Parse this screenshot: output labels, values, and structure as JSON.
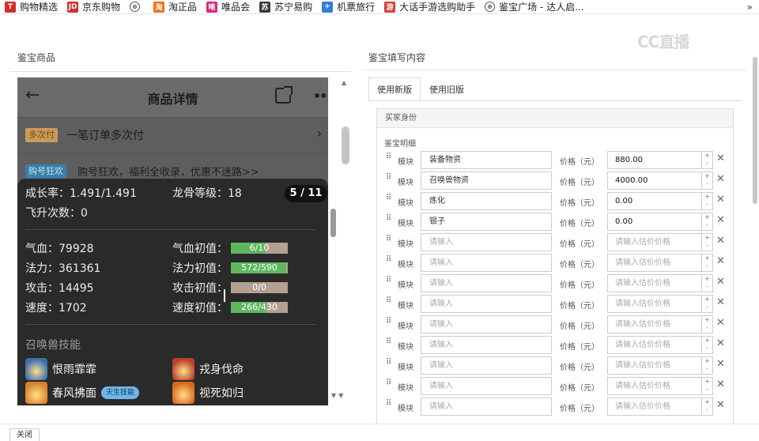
{
  "bookmarks": [
    {
      "label": "购物精选",
      "icon": "shopping-icon",
      "color": "#d62e2e",
      "glyph": "T"
    },
    {
      "label": "京东购物",
      "icon": "jd-icon",
      "color": "#d63028",
      "glyph": "JD"
    },
    {
      "label": "",
      "icon": "globe-icon",
      "color": "",
      "glyph": "⊕"
    },
    {
      "label": "淘正品",
      "icon": "taobao-icon",
      "color": "#f5700f",
      "glyph": "淘"
    },
    {
      "label": "唯品会",
      "icon": "vip-icon",
      "color": "#d6297a",
      "glyph": "唯"
    },
    {
      "label": "苏宁易购",
      "icon": "suning-icon",
      "color": "#3a3a3a",
      "glyph": "苏"
    },
    {
      "label": "机票旅行",
      "icon": "travel-icon",
      "color": "#2d7fd6",
      "glyph": "✈"
    },
    {
      "label": "大话手游选购助手",
      "icon": "game-icon",
      "color": "#d63c3c",
      "glyph": "游"
    },
    {
      "label": "鉴宝广场 - 达人启...",
      "icon": "globe-icon",
      "color": "",
      "glyph": "⊕"
    }
  ],
  "bookmarks_more": "»",
  "watermark": "CC直播",
  "left_panel": {
    "title": "鉴宝商品",
    "phone": {
      "back": "←",
      "title": "商品详情",
      "rows": [
        {
          "tag": "多次付",
          "text": "一笔订单多次付",
          "arrow": "›"
        },
        {
          "tag": "购号狂欢",
          "text": "购号狂欢，福利全收录，优惠不迷路>>",
          "arrow": "›"
        }
      ]
    },
    "popup": {
      "page": "5 / 11",
      "growth": "成长率：1.491/1.491",
      "dragon": "龙骨等级：18",
      "ascend": "飞升次数：0",
      "stats": [
        {
          "name": "气血：79928",
          "init_label": "气血初值：",
          "bar": "6/10",
          "fill": 0.6
        },
        {
          "name": "法力：361361",
          "init_label": "法力初值：",
          "bar": "572/590",
          "fill": 0.97
        },
        {
          "name": "攻击：14495",
          "init_label": "攻击初值：",
          "bar": "0/0",
          "fill": 0
        },
        {
          "name": "速度：1702",
          "init_label": "速度初值：",
          "bar": "266/430",
          "fill": 0.62
        }
      ],
      "skills_title": "召唤兽技能",
      "skills": [
        {
          "name": "恨雨霏霏",
          "icon": "rain-skill-icon",
          "badge": ""
        },
        {
          "name": "戎身伐命",
          "icon": "fire-skill-icon",
          "badge": ""
        },
        {
          "name": "春风拂面",
          "icon": "wind-skill-icon",
          "badge": "天生技能"
        },
        {
          "name": "视死如归",
          "icon": "flame-skill-icon",
          "badge": ""
        }
      ]
    }
  },
  "right_panel": {
    "title": "鉴宝填写内容",
    "tabs": [
      "使用新版",
      "使用旧版"
    ],
    "section_title": "买家身份",
    "sub_label": "鉴宝明细",
    "module_label": "模块",
    "price_label": "价格（元）",
    "rows": [
      {
        "module": "装备物资",
        "price": "880.00"
      },
      {
        "module": "召唤兽物资",
        "price": "4000.00"
      },
      {
        "module": "炼化",
        "price": "0.00"
      },
      {
        "module": "银子",
        "price": "0.00"
      },
      {
        "module": "",
        "price": ""
      },
      {
        "module": "",
        "price": ""
      },
      {
        "module": "",
        "price": ""
      },
      {
        "module": "",
        "price": ""
      },
      {
        "module": "",
        "price": ""
      },
      {
        "module": "",
        "price": ""
      },
      {
        "module": "",
        "price": ""
      },
      {
        "module": "",
        "price": ""
      },
      {
        "module": "",
        "price": ""
      }
    ],
    "module_placeholder": "请输入",
    "price_placeholder": "请输入估价价格"
  },
  "footer": {
    "close": "关闭"
  },
  "colors": {
    "bar_fill": "#5fb860",
    "bar_bg": "#b3a090",
    "popup_bg": "#2a2a2a"
  }
}
